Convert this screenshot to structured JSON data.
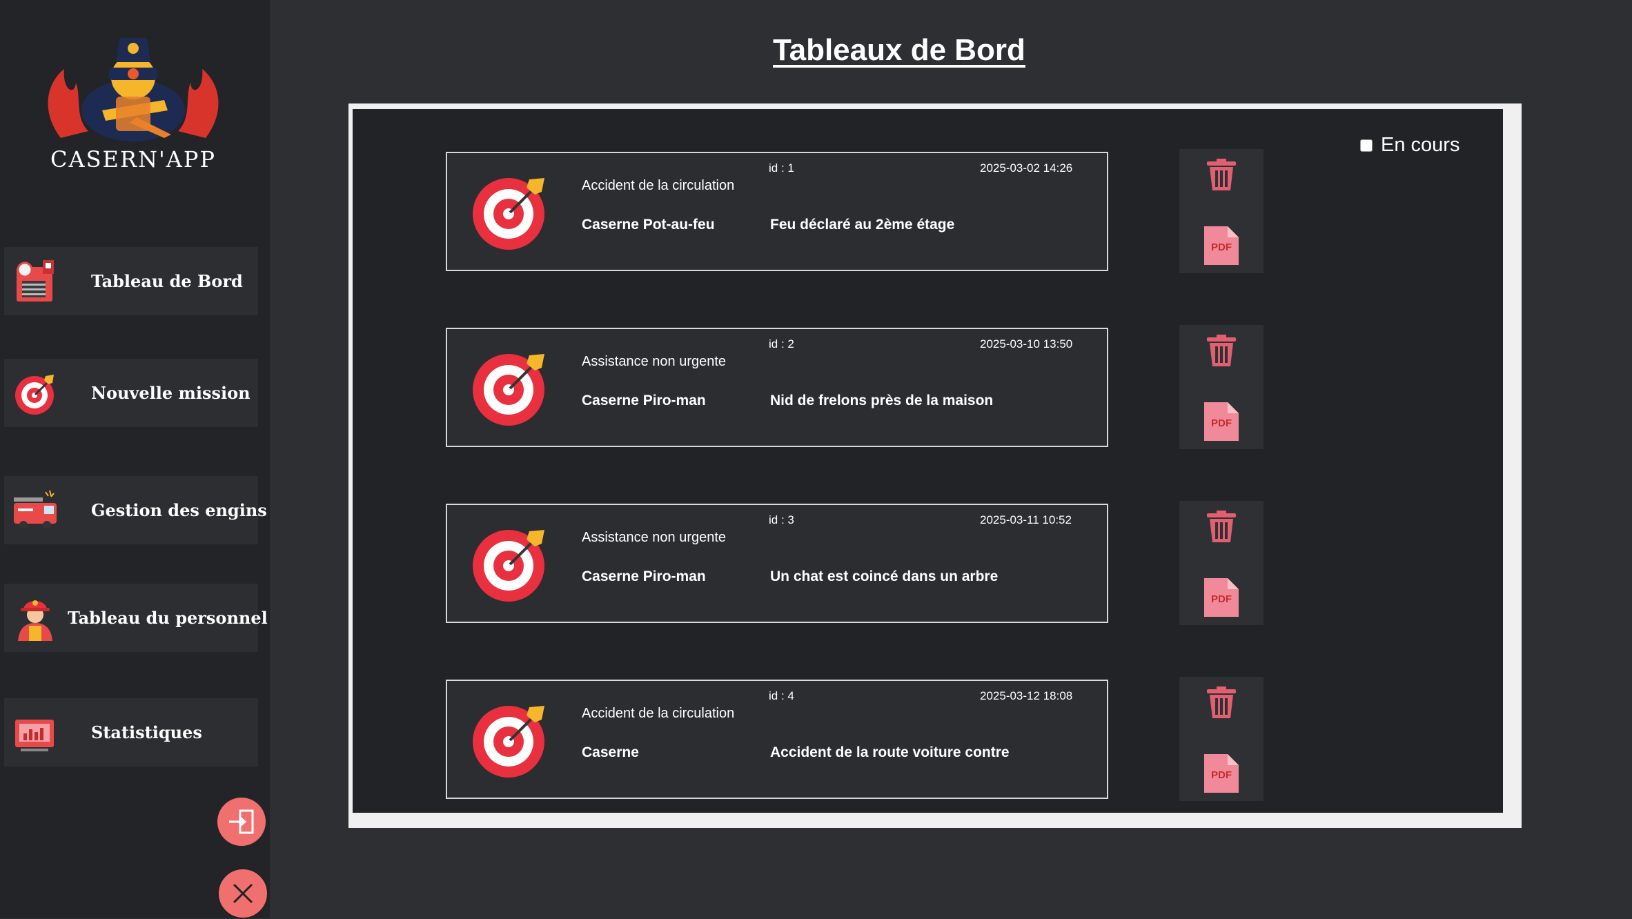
{
  "app": {
    "logo_text": "CASERN'APP"
  },
  "sidebar": {
    "items": [
      {
        "label": "Tableau de Bord",
        "icon": "dashboard-icon"
      },
      {
        "label": "Nouvelle mission",
        "icon": "target-icon"
      },
      {
        "label": "Gestion des engins",
        "icon": "fire-truck-icon"
      },
      {
        "label": "Tableau du personnel",
        "icon": "firefighter-icon"
      },
      {
        "label": "Statistiques",
        "icon": "chart-icon"
      }
    ],
    "logout_icon": "logout-icon",
    "close_icon": "close-icon"
  },
  "main": {
    "title": "Tableaux de Bord",
    "filter": {
      "label": "En cours",
      "checked": false
    },
    "missions": [
      {
        "id": "id : 1",
        "date": "2025-03-02 14:26",
        "type": "Accident de la circulation",
        "caserne": "Caserne Pot-au-feu",
        "description": "Feu déclaré au 2ème étage"
      },
      {
        "id": "id : 2",
        "date": "2025-03-10 13:50",
        "type": "Assistance non urgente",
        "caserne": "Caserne Piro-man",
        "description": "Nid de frelons près de la maison"
      },
      {
        "id": "id : 3",
        "date": "2025-03-11 10:52",
        "type": "Assistance non urgente",
        "caserne": "Caserne Piro-man",
        "description": "Un chat est coincé dans un arbre"
      },
      {
        "id": "id : 4",
        "date": "2025-03-12 18:08",
        "type": "Accident de la circulation",
        "caserne": "Caserne",
        "description": "Accident de la route voiture contre"
      }
    ],
    "pdf_label": "PDF"
  },
  "colors": {
    "background": "#2d2f33",
    "sidebar": "#232427",
    "accent_red": "#e8303e",
    "pink": "#f08a9a",
    "trash": "#e06070"
  }
}
